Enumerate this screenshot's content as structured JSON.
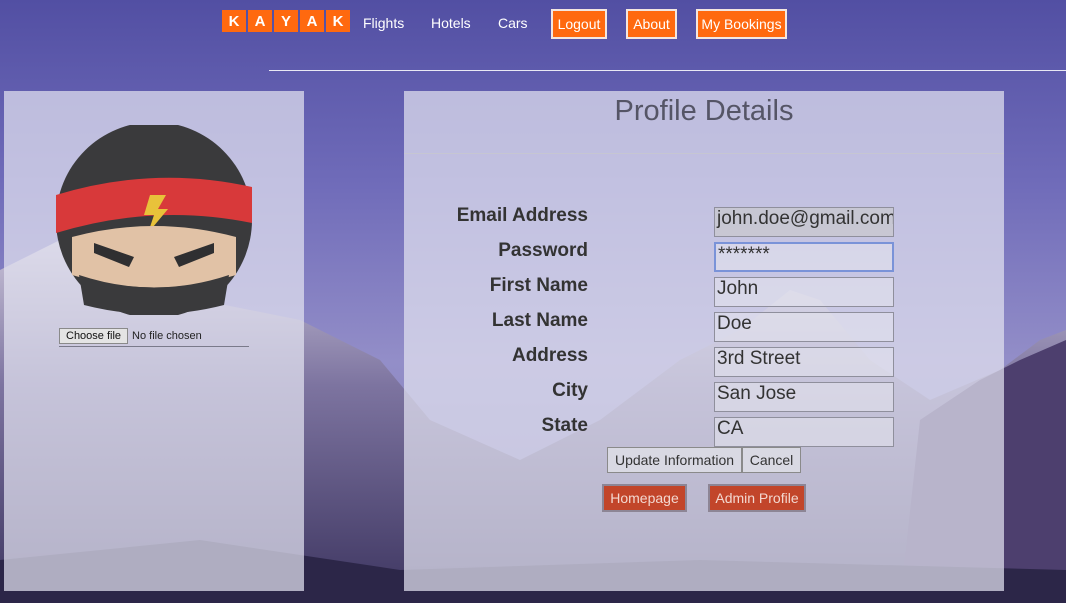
{
  "nav": {
    "logo_letters": [
      "K",
      "A",
      "Y",
      "A",
      "K"
    ],
    "links": {
      "flights": "Flights",
      "hotels": "Hotels",
      "cars": "Cars"
    },
    "buttons": {
      "logout": "Logout",
      "about": "About",
      "bookings": "My Bookings"
    }
  },
  "left": {
    "choose_file": "Choose file",
    "file_status": "No file chosen"
  },
  "profile": {
    "title": "Profile Details",
    "labels": {
      "email": "Email Address",
      "password": "Password",
      "first_name": "First Name",
      "last_name": "Last Name",
      "address": "Address",
      "city": "City",
      "state": "State"
    },
    "values": {
      "email": "john.doe@gmail.com",
      "password": "*******",
      "first_name": "John",
      "last_name": "Doe",
      "address": "3rd Street",
      "city": "San Jose",
      "state": "CA"
    },
    "buttons": {
      "update": "Update Information",
      "cancel": "Cancel",
      "homepage": "Homepage",
      "admin": "Admin Profile"
    }
  },
  "colors": {
    "brand_orange": "#ff690f",
    "danger_button": "#c2452a"
  },
  "icons": {
    "avatar": "ninja-avatar"
  }
}
